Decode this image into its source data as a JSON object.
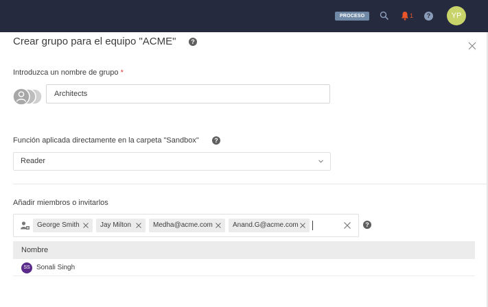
{
  "topbar": {
    "process_badge": "PROCESO",
    "notification_count": "1",
    "help_glyph": "?",
    "user_initials": "YP",
    "colors": {
      "background": "#252a3e",
      "badge": "#6f89a6",
      "bell": "#e8552a",
      "avatar": "#c8d46a"
    }
  },
  "dialog": {
    "title": "Crear grupo para el equipo \"ACME\"",
    "help_glyph": "?",
    "close_icon": "close-icon",
    "group_name": {
      "label": "Introduzca un nombre de grupo",
      "required_mark": "*",
      "value": "Architects"
    },
    "role": {
      "label": "Función aplicada directamente en la carpeta \"Sandbox\"",
      "selected": "Reader"
    },
    "members": {
      "label": "Añadir miembros o invitarlos",
      "chips": [
        {
          "label": "George Smith"
        },
        {
          "label": "Jay Milton"
        },
        {
          "label": "Medha@acme.com"
        },
        {
          "label": "Anand.G@acme.com"
        }
      ]
    },
    "results": {
      "header": "Nombre",
      "rows": [
        {
          "initials": "SS",
          "name": "Sonali Singh",
          "avatar_color": "#5a2b8a"
        }
      ]
    }
  }
}
